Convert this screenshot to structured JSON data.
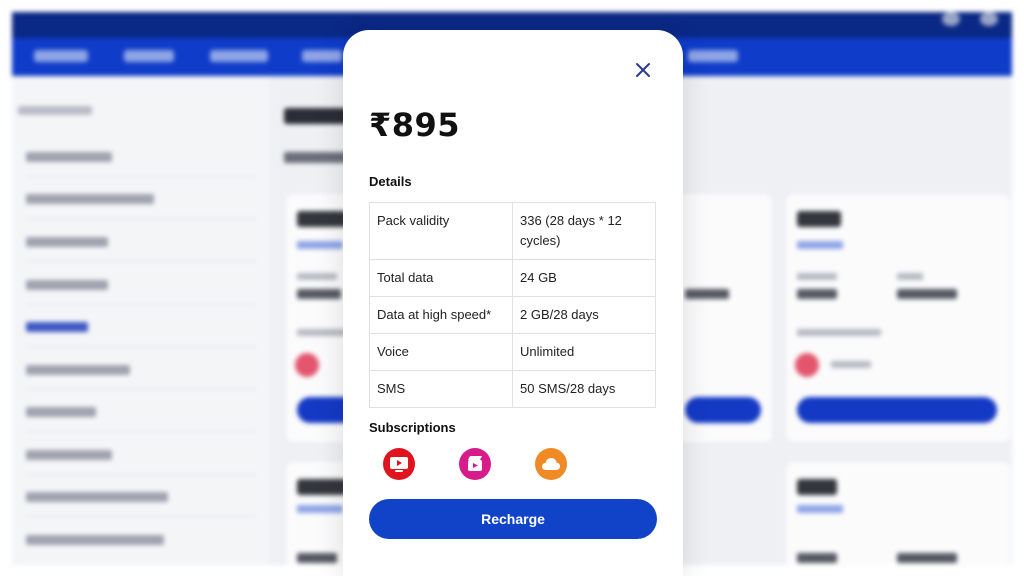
{
  "modal": {
    "price": "₹895",
    "details_heading": "Details",
    "details": [
      {
        "label": "Pack validity",
        "value": "336 (28 days * 12 cycles)"
      },
      {
        "label": "Total data",
        "value": "24 GB"
      },
      {
        "label": "Data at high speed*",
        "value": "2 GB/28 days"
      },
      {
        "label": "Voice",
        "value": "Unlimited"
      },
      {
        "label": "SMS",
        "value": "50 SMS/28 days"
      }
    ],
    "subscriptions_heading": "Subscriptions",
    "subscriptions": [
      {
        "icon": "jiotv-icon",
        "color": "#e0141e"
      },
      {
        "icon": "jiocinema-icon",
        "color": "#d81b8a"
      },
      {
        "icon": "jiocloud-icon",
        "color": "#f08a24"
      }
    ],
    "recharge_label": "Recharge",
    "close_icon": "close-icon"
  },
  "colors": {
    "primary": "#1043c8",
    "nav": "#0f3cc9",
    "header": "#0a2885"
  }
}
